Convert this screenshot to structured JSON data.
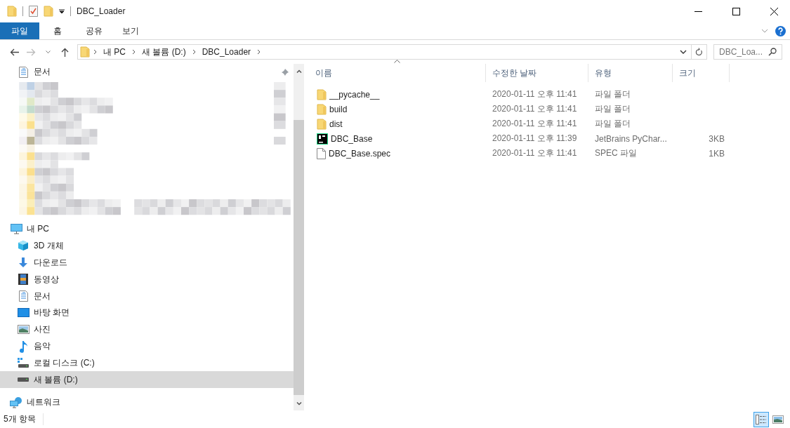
{
  "title_bar": {
    "title": "DBC_Loader"
  },
  "ribbon_tabs": [
    {
      "label": "파일",
      "selected": true
    },
    {
      "label": "홈",
      "selected": false
    },
    {
      "label": "공유",
      "selected": false
    },
    {
      "label": "보기",
      "selected": false
    }
  ],
  "address_bar": {
    "path": [
      "내 PC",
      "새 볼륨 (D:)",
      "DBC_Loader"
    ]
  },
  "search": {
    "placeholder": "DBC_Loa..."
  },
  "navigation": {
    "quick_access": [
      {
        "label": "문서",
        "kind": "documents",
        "pinned": true,
        "selected": false
      }
    ],
    "tree": [
      {
        "label": "내 PC",
        "kind": "pc",
        "selected": false,
        "children": [
          {
            "label": "3D 개체",
            "kind": "cube",
            "selected": false
          },
          {
            "label": "다운로드",
            "kind": "download",
            "selected": false
          },
          {
            "label": "동영상",
            "kind": "video",
            "selected": false
          },
          {
            "label": "문서",
            "kind": "documents",
            "selected": false
          },
          {
            "label": "바탕 화면",
            "kind": "desktop",
            "selected": false
          },
          {
            "label": "사진",
            "kind": "pictures",
            "selected": false
          },
          {
            "label": "음악",
            "kind": "music",
            "selected": false
          },
          {
            "label": "로컬 디스크 (C:)",
            "kind": "system_drive",
            "selected": false
          },
          {
            "label": "새 볼륨 (D:)",
            "kind": "drive",
            "selected": true
          }
        ]
      },
      {
        "label": "네트워크",
        "kind": "network",
        "selected": false
      }
    ]
  },
  "file_list": {
    "columns": [
      {
        "label": "이름",
        "sorted": true
      },
      {
        "label": "수정한 날짜",
        "sorted": false
      },
      {
        "label": "유형",
        "sorted": false
      },
      {
        "label": "크기",
        "sorted": false
      }
    ],
    "rows": [
      {
        "kind": "folder",
        "name": "__pycache__",
        "modified": "2020-01-11 오후 11:41",
        "type": "파일 폴더"
      },
      {
        "kind": "folder",
        "name": "build",
        "modified": "2020-01-11 오후 11:41",
        "type": "파일 폴더"
      },
      {
        "kind": "folder",
        "name": "dist",
        "modified": "2020-01-11 오후 11:41",
        "type": "파일 폴더"
      },
      {
        "kind": "pycharm",
        "name": "DBC_Base",
        "modified": "2020-01-11 오후 11:39",
        "type": "JetBrains PyChar...",
        "size": "3KB"
      },
      {
        "kind": "file",
        "name": "DBC_Base.spec",
        "modified": "2020-01-11 오후 11:41",
        "type": "SPEC 파일",
        "size": "1KB"
      }
    ]
  },
  "status_bar": {
    "item_count": "5개 항목"
  },
  "view_buttons": [
    {
      "kind": "details",
      "selected": true
    },
    {
      "kind": "thumbnails",
      "selected": false
    }
  ]
}
